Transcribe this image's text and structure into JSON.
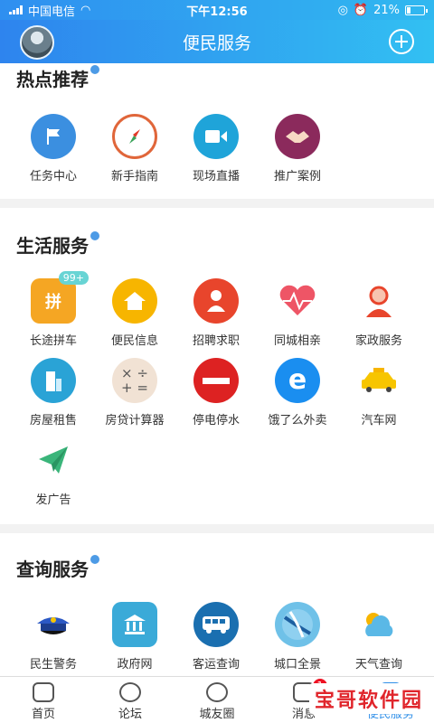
{
  "status": {
    "carrier": "中国电信",
    "time": "下午12:56",
    "battery": "21%"
  },
  "nav": {
    "title": "便民服务"
  },
  "sections": [
    {
      "title": "热点推荐",
      "items": [
        "任务中心",
        "新手指南",
        "现场直播",
        "推广案例"
      ]
    },
    {
      "title": "生活服务",
      "items": [
        "长途拼车",
        "便民信息",
        "招聘求职",
        "同城相亲",
        "家政服务",
        "房屋租售",
        "房贷计算器",
        "停电停水",
        "饿了么外卖",
        "汽车网",
        "发广告"
      ],
      "badge": "99+"
    },
    {
      "title": "查询服务",
      "items": [
        "民生警务",
        "政府网",
        "客运查询",
        "城口全景",
        "天气查询"
      ]
    }
  ],
  "tabs": [
    {
      "label": "首页",
      "active": false
    },
    {
      "label": "论坛",
      "active": false
    },
    {
      "label": "城友圈",
      "active": false
    },
    {
      "label": "消息",
      "active": false,
      "badge": "1"
    },
    {
      "label": "便民服务",
      "active": true
    }
  ],
  "watermark": "宝哥软件园",
  "colors": {
    "accent": "#2f8fe8",
    "header_start": "#2e84ee",
    "header_end": "#32c0f2"
  }
}
